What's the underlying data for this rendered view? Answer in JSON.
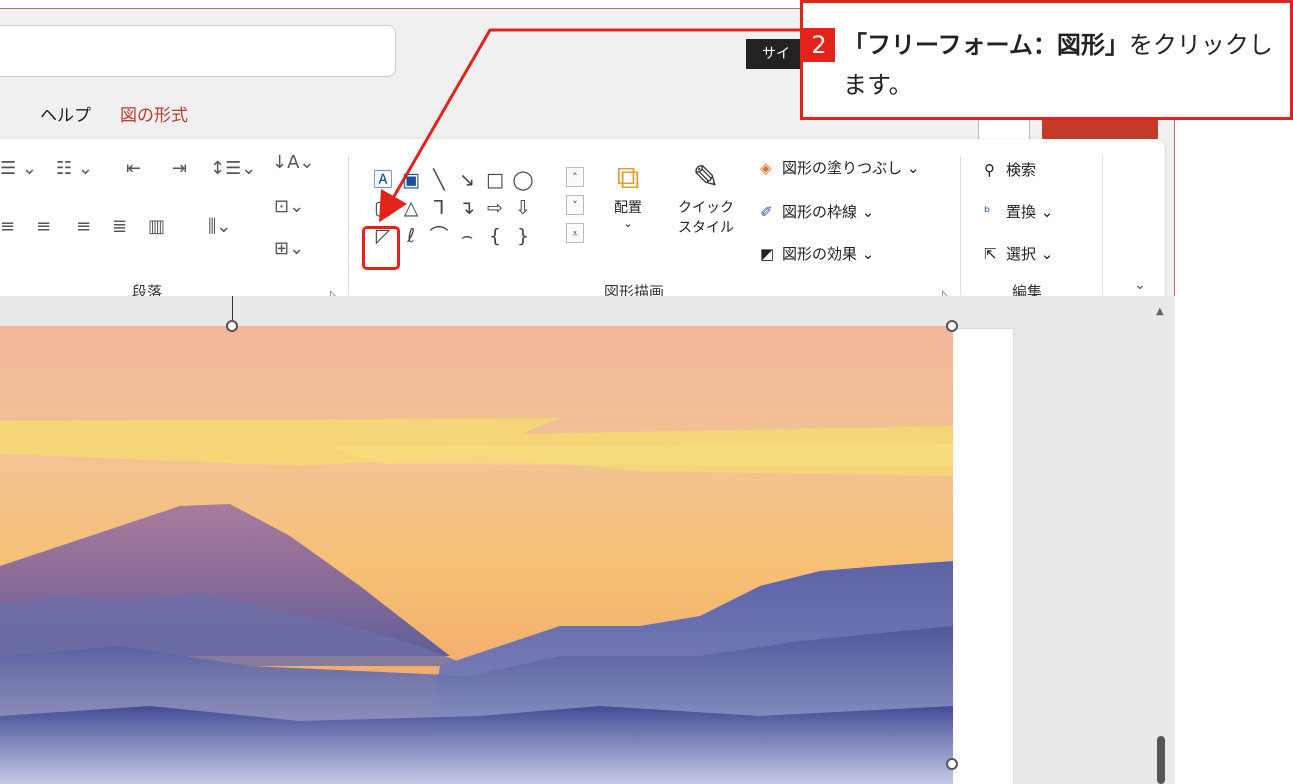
{
  "tooltip": {
    "site_text": "サイ"
  },
  "tabs": [
    {
      "label": "ヘルプ"
    },
    {
      "label": "図の形式"
    }
  ],
  "ribbon": {
    "paragraph_group_label": "段落",
    "drawing_group_label": "図形描画",
    "editing_group_label": "編集",
    "arrange_label": "配置",
    "quick_style_label1": "クイック",
    "quick_style_label2": "スタイル",
    "shape_fill_label": "図形の塗りつぶし",
    "shape_outline_label": "図形の枠線",
    "shape_effects_label": "図形の効果",
    "find_label": "検索",
    "replace_label": "置換",
    "select_label": "選択"
  },
  "callout": {
    "step_number": "2",
    "text_bold": "「フリーフォーム：図形」",
    "text_rest": "をクリックします。"
  },
  "colors": {
    "accent_red": "#e2231a",
    "tab_active": "#c0392b"
  }
}
